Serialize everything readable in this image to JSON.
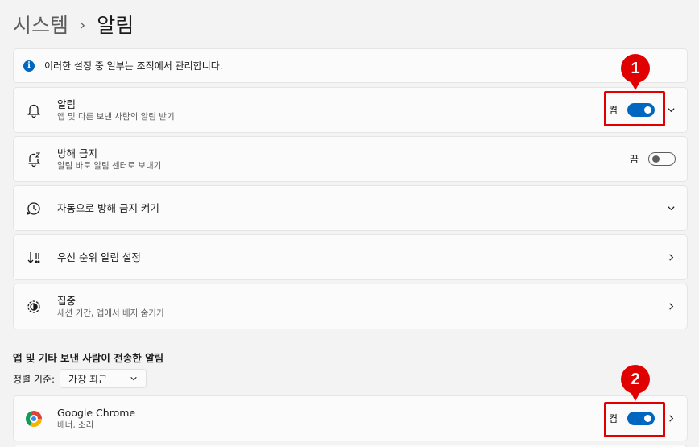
{
  "breadcrumb": {
    "parent": "시스템",
    "separator": "›",
    "current": "알림"
  },
  "info": {
    "icon": "info-icon",
    "text": "이러한 설정 중 일부는 조직에서 관리합니다."
  },
  "rows": {
    "notifications": {
      "icon": "bell-icon",
      "title": "알림",
      "subtitle": "앱 및 다른 보낸 사람의 알림 받기",
      "toggle_label": "켬",
      "toggle_state": "on"
    },
    "dnd": {
      "icon": "bell-snooze-icon",
      "title": "방해 금지",
      "subtitle": "알림 바로 알림 센터로 보내기",
      "toggle_label": "끔",
      "toggle_state": "off"
    },
    "auto_dnd": {
      "icon": "clock-icon",
      "title": "자동으로 방해 금지 켜기"
    },
    "priority": {
      "icon": "priority-sort-icon",
      "title": "우선 순위 알림 설정"
    },
    "focus": {
      "icon": "focus-icon",
      "title": "집중",
      "subtitle": "세션 기간, 앱에서 배지 숨기기"
    },
    "chrome": {
      "icon": "chrome-icon",
      "title": "Google Chrome",
      "subtitle": "배너, 소리",
      "toggle_label": "켬",
      "toggle_state": "on"
    }
  },
  "apps_section": {
    "title": "앱 및 기타 보낸 사람이 전송한 알림",
    "sort_label": "정렬 기준:",
    "sort_value": "가장 최근"
  },
  "annotations": {
    "marker1": "1",
    "marker2": "2"
  },
  "colors": {
    "accent": "#0067c0",
    "callout": "#e00000"
  }
}
